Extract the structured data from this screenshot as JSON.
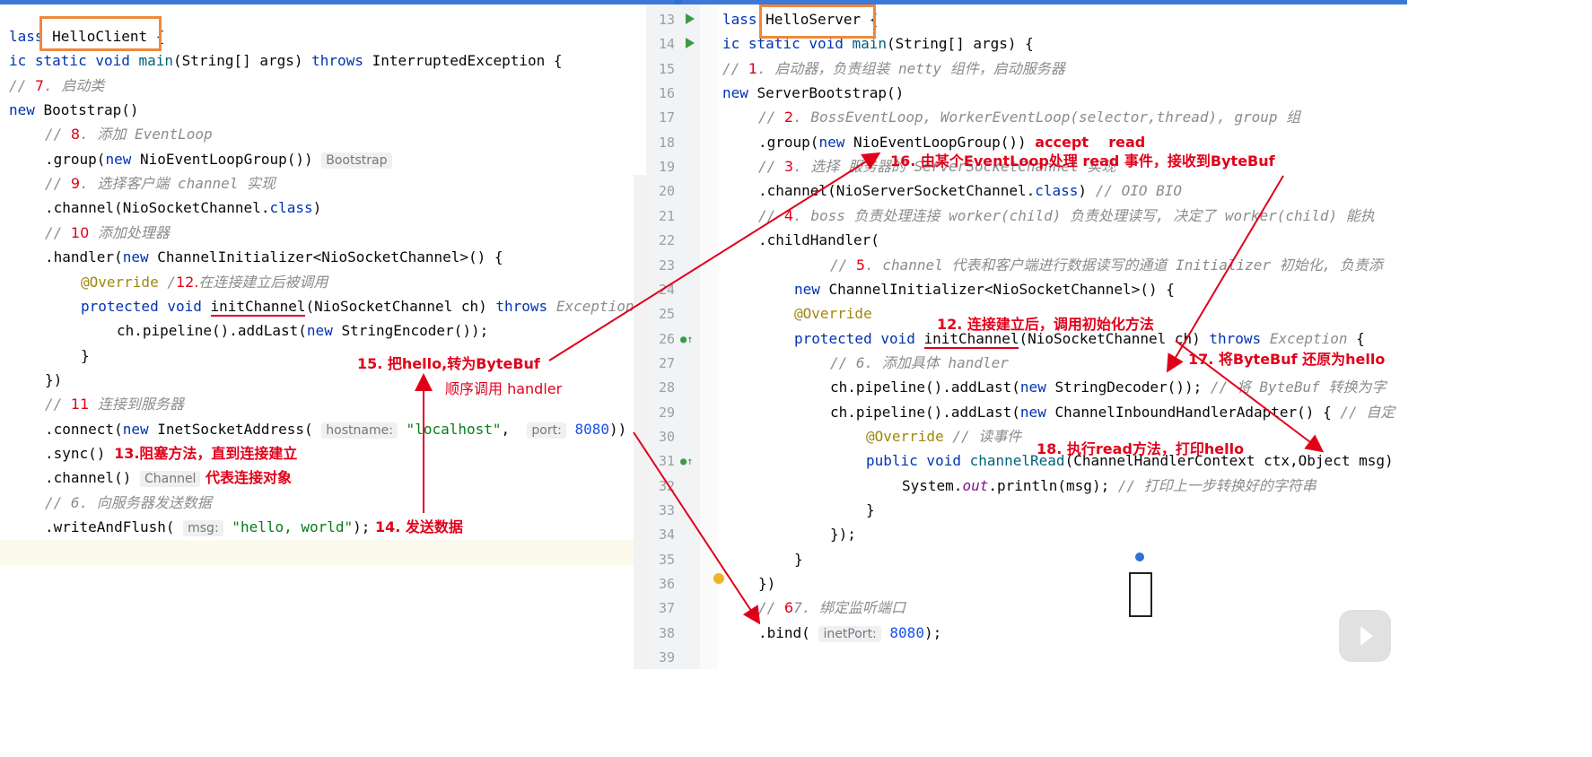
{
  "left_editor": {
    "lines": [
      {
        "parts": [
          [
            "kw",
            "lass "
          ],
          [
            "hl",
            ""
          ],
          [
            "",
            "HelloClient"
          ],
          [
            "",
            " {"
          ]
        ]
      },
      {
        "parts": [
          [
            "kw",
            "ic static void "
          ],
          [
            "fn",
            "main"
          ],
          [
            "",
            "(String[] args) "
          ],
          [
            "kw",
            "throws "
          ],
          [
            "",
            "InterruptedException {"
          ]
        ]
      },
      {
        "parts": [
          [
            "cm",
            "// "
          ],
          [
            "redn",
            "7"
          ],
          [
            "cm",
            ". 启动类"
          ]
        ]
      },
      {
        "parts": [
          [
            "kw",
            "new "
          ],
          [
            "",
            "Bootstrap()"
          ]
        ]
      },
      {
        "parts": [
          [
            "cm",
            "// "
          ],
          [
            "redn",
            "8"
          ],
          [
            "cm",
            ". 添加 EventLoop"
          ]
        ]
      },
      {
        "parts": [
          [
            "",
            ".group("
          ],
          [
            "kw",
            "new "
          ],
          [
            "",
            "NioEventLoopGroup()) "
          ],
          [
            "hint",
            "Bootstrap"
          ]
        ]
      },
      {
        "parts": [
          [
            "cm",
            "// "
          ],
          [
            "redn",
            "9"
          ],
          [
            "cm",
            ". 选择客户端 channel 实现"
          ]
        ]
      },
      {
        "parts": [
          [
            "",
            ".channel(NioSocketChannel."
          ],
          [
            "kw",
            "class"
          ],
          [
            "",
            ")"
          ]
        ]
      },
      {
        "parts": [
          [
            "cm",
            "// "
          ],
          [
            "redn",
            "10"
          ],
          [
            "cm",
            " 添加处理器"
          ]
        ]
      },
      {
        "parts": [
          [
            "",
            ".handler("
          ],
          [
            "kw",
            "new "
          ],
          [
            "",
            "ChannelInitializer<NioSocketChannel>() {"
          ]
        ]
      },
      {
        "parts": [
          [
            "an",
            "@Override "
          ],
          [
            "cm",
            "/"
          ],
          [
            "redn",
            "12."
          ],
          [
            "cm",
            "在连接建立后被调用"
          ]
        ]
      },
      {
        "parts": [
          [
            "kw",
            "protected void "
          ],
          [
            "ul",
            "initChannel"
          ],
          [
            "",
            "(NioSocketChannel ch) "
          ],
          [
            "kw",
            "throws "
          ],
          [
            "cm",
            "Exception"
          ]
        ]
      },
      {
        "parts": [
          [
            "",
            "ch.pipeline().addLast("
          ],
          [
            "kw",
            "new "
          ],
          [
            "",
            "StringEncoder());"
          ]
        ]
      },
      {
        "parts": [
          [
            "",
            "}"
          ]
        ]
      },
      {
        "parts": [
          [
            "",
            "})"
          ]
        ]
      },
      {
        "parts": [
          [
            "cm",
            "// "
          ],
          [
            "redn",
            "11"
          ],
          [
            "cm",
            " 连接到服务器"
          ]
        ]
      },
      {
        "parts": [
          [
            "",
            ".connect("
          ],
          [
            "kw",
            "new "
          ],
          [
            "",
            "InetSocketAddress( "
          ],
          [
            "hint",
            "hostname:"
          ],
          [
            "st",
            " \"localhost\""
          ],
          [
            "",
            ",  "
          ],
          [
            "hint",
            "port:"
          ],
          [
            "nm",
            " 8080"
          ],
          [
            "",
            "))"
          ]
        ]
      },
      {
        "parts": [
          [
            "",
            ".sync() "
          ],
          [
            "red",
            "13.阻塞方法，直到连接建立"
          ]
        ]
      },
      {
        "parts": [
          [
            "",
            ".channel() "
          ],
          [
            "hint",
            "Channel"
          ],
          [
            "red",
            " 代表连接对象"
          ]
        ]
      },
      {
        "parts": [
          [
            "cm",
            "// 6. 向服务器发送数据"
          ]
        ]
      },
      {
        "parts": [
          [
            "",
            ".writeAndFlush( "
          ],
          [
            "hint",
            "msg:"
          ],
          [
            "st",
            " \"hello, world\""
          ],
          [
            "",
            ");"
          ],
          [
            "red",
            " 14. 发送数据"
          ]
        ]
      }
    ]
  },
  "right_editor": {
    "line_numbers": [
      "13",
      "14",
      "15",
      "16",
      "17",
      "18",
      "19",
      "20",
      "21",
      "22",
      "23",
      "24",
      "25",
      "26",
      "27",
      "28",
      "29",
      "30",
      "31",
      "32",
      "33",
      "34",
      "35",
      "36",
      "37",
      "38",
      "39"
    ],
    "lines": [
      {
        "parts": [
          [
            "kw",
            "lass "
          ],
          [
            "",
            "HelloServer"
          ],
          [
            "",
            " {"
          ]
        ]
      },
      {
        "parts": [
          [
            "kw",
            "ic static void "
          ],
          [
            "fn",
            "main"
          ],
          [
            "",
            "(String[] args) {"
          ]
        ]
      },
      {
        "parts": [
          [
            "cm",
            "// "
          ],
          [
            "redn",
            "1"
          ],
          [
            "cm",
            ". 启动器，负责组装 netty 组件，启动服务器"
          ]
        ]
      },
      {
        "parts": [
          [
            "kw",
            "new "
          ],
          [
            "",
            "ServerBootstrap()"
          ]
        ]
      },
      {
        "parts": [
          [
            "cm",
            "// "
          ],
          [
            "redn",
            "2"
          ],
          [
            "cm",
            ". BossEventLoop, WorkerEventLoop(selector,thread), group 组"
          ]
        ]
      },
      {
        "parts": [
          [
            "",
            ".group("
          ],
          [
            "kw",
            "new "
          ],
          [
            "",
            "NioEventLoopGroup()) "
          ],
          [
            "red",
            "accept    read"
          ]
        ]
      },
      {
        "parts": [
          [
            "cm",
            "// "
          ],
          [
            "redn",
            "3"
          ],
          [
            "cm",
            ". 选择 服务器的 ServerSocketChannel 实现"
          ]
        ]
      },
      {
        "parts": [
          [
            "",
            ".channel(NioServerSocketChannel."
          ],
          [
            "kw",
            "class"
          ],
          [
            "",
            ") "
          ],
          [
            "cm",
            "// OIO BIO"
          ]
        ]
      },
      {
        "parts": [
          [
            "cm",
            "// "
          ],
          [
            "redn",
            "4"
          ],
          [
            "cm",
            ". boss 负责处理连接 worker(child) 负责处理读写, 决定了 worker(child) 能执"
          ]
        ]
      },
      {
        "parts": [
          [
            "",
            ".childHandler("
          ]
        ]
      },
      {
        "parts": [
          [
            "cm",
            "// "
          ],
          [
            "redn",
            "5"
          ],
          [
            "cm",
            ". channel 代表和客户端进行数据读写的通道 Initializer 初始化, 负责添"
          ]
        ]
      },
      {
        "parts": [
          [
            "kw",
            "new "
          ],
          [
            "",
            "ChannelInitializer<NioSocketChannel>() {"
          ]
        ]
      },
      {
        "parts": [
          [
            "an",
            "@Override"
          ]
        ]
      },
      {
        "parts": [
          [
            "kw",
            "protected void "
          ],
          [
            "ul",
            "initChannel"
          ],
          [
            "",
            "(NioSocketChannel ch) "
          ],
          [
            "kw",
            "throws "
          ],
          [
            "cm",
            "Exception"
          ],
          [
            "",
            " {"
          ]
        ]
      },
      {
        "parts": [
          [
            "cm",
            "// 6. 添加具体 handler"
          ]
        ]
      },
      {
        "parts": [
          [
            "",
            "ch.pipeline().addLast("
          ],
          [
            "kw",
            "new "
          ],
          [
            "",
            "StringDecoder()); "
          ],
          [
            "cm",
            "// 将 ByteBuf 转换为字"
          ]
        ]
      },
      {
        "parts": [
          [
            "",
            "ch.pipeline().addLast("
          ],
          [
            "kw",
            "new "
          ],
          [
            "",
            "ChannelInboundHandlerAdapter() { "
          ],
          [
            "cm",
            "// 自定"
          ]
        ]
      },
      {
        "parts": [
          [
            "an",
            "@Override "
          ],
          [
            "cm",
            "// 读事件"
          ]
        ]
      },
      {
        "parts": [
          [
            "kw",
            "public void "
          ],
          [
            "fn",
            "channelRead"
          ],
          [
            "",
            "(ChannelHandlerContext ctx,Object msg)"
          ]
        ]
      },
      {
        "parts": [
          [
            "",
            "System."
          ],
          [
            "pv",
            "out"
          ],
          [
            "",
            ".println(msg); "
          ],
          [
            "cm",
            "// 打印上一步转换好的字符串"
          ]
        ]
      },
      {
        "parts": [
          [
            "",
            "}"
          ]
        ]
      },
      {
        "parts": [
          [
            "",
            "});"
          ]
        ]
      },
      {
        "parts": [
          [
            "",
            "}"
          ]
        ]
      },
      {
        "parts": [
          [
            "",
            "})"
          ]
        ]
      },
      {
        "parts": [
          [
            "cm",
            "// "
          ],
          [
            "redn",
            "6"
          ],
          [
            "cm",
            "7. 绑定监听端口"
          ]
        ]
      },
      {
        "parts": [
          [
            "",
            ".bind( "
          ],
          [
            "hint",
            "inetPort:"
          ],
          [
            "nm",
            " 8080"
          ],
          [
            "",
            ");"
          ]
        ]
      },
      {
        "parts": [
          [
            "",
            ""
          ]
        ]
      }
    ]
  },
  "annotations": {
    "a15": "15. 把hello,转为ByteBuf",
    "a15_sub": "顺序调用 handler",
    "a16": "16. 由某个EventLoop处理 read 事件，接收到ByteBuf",
    "a12": "12. 连接建立后，调用初始化方法",
    "a17": "17. 将ByteBuf 还原为hello",
    "a18": "18. 执行read方法，打印hello"
  },
  "colors": {
    "keyword": "#0033b3",
    "comment": "#8c8c8c",
    "string": "#067d17",
    "annotation_red": "#e1001a",
    "highlight_box": "#f0883a"
  }
}
